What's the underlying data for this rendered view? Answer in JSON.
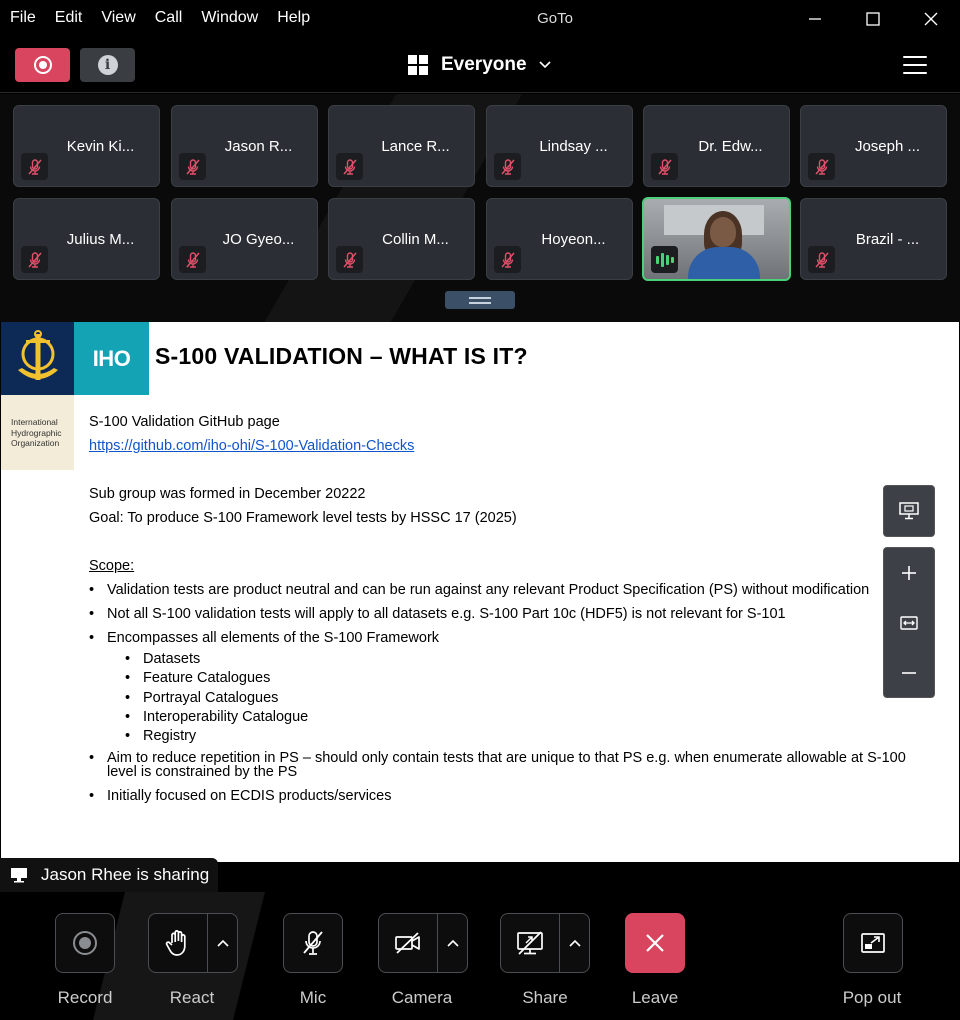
{
  "window": {
    "title": "GoTo",
    "menu": [
      "File",
      "Edit",
      "View",
      "Call",
      "Window",
      "Help"
    ]
  },
  "toolbar": {
    "view_label": "Everyone"
  },
  "participants": [
    {
      "name": "Kevin Ki..."
    },
    {
      "name": "Jason R..."
    },
    {
      "name": "Lance R..."
    },
    {
      "name": "Lindsay ..."
    },
    {
      "name": "Dr. Edw..."
    },
    {
      "name": "Joseph ..."
    },
    {
      "name": "Julius M..."
    },
    {
      "name": "JO Gyeo..."
    },
    {
      "name": "Collin M..."
    },
    {
      "name": "Hoyeon..."
    },
    {
      "name": ""
    },
    {
      "name": "Brazil - ..."
    }
  ],
  "slide": {
    "logo_text": "IHO",
    "org_lines": [
      "International",
      "Hydrographic",
      "Organization"
    ],
    "title": "S-100 VALIDATION – WHAT IS IT?",
    "line1": "S-100 Validation GitHub page",
    "link": "https://github.com/iho-ohi/S-100-Validation-Checks",
    "line2": "Sub group was formed in December 20222",
    "line3": "Goal:  To produce S-100 Framework level tests by HSSC 17 (2025)",
    "scope_label": "Scope:",
    "bullets": [
      "Validation tests are product neutral and can be run against any relevant Product Specification (PS) without modification",
      "Not all S-100 validation tests will apply to all datasets e.g. S-100 Part 10c (HDF5) is not relevant for S-101",
      "Encompasses all elements of the S-100 Framework"
    ],
    "sub_bullets": [
      "Datasets",
      "Feature Catalogues",
      "Portrayal Catalogues",
      "Interoperability Catalogue",
      "Registry"
    ],
    "bullets_after": [
      "Aim to reduce repetition in PS – should only contain tests that are unique to that PS e.g. when enumerate allowable at S-100 level is constrained by the PS",
      "Initially focused on ECDIS products/services"
    ]
  },
  "sharing": {
    "text": "Jason Rhee is sharing"
  },
  "controls": {
    "record": "Record",
    "react": "React",
    "mic": "Mic",
    "camera": "Camera",
    "share": "Share",
    "leave": "Leave",
    "popout": "Pop out"
  },
  "colors": {
    "record_accent": "#d9455f",
    "speaking_green": "#4bd17a",
    "iho_navy": "#0d2a57",
    "iho_teal": "#14a3b4"
  }
}
